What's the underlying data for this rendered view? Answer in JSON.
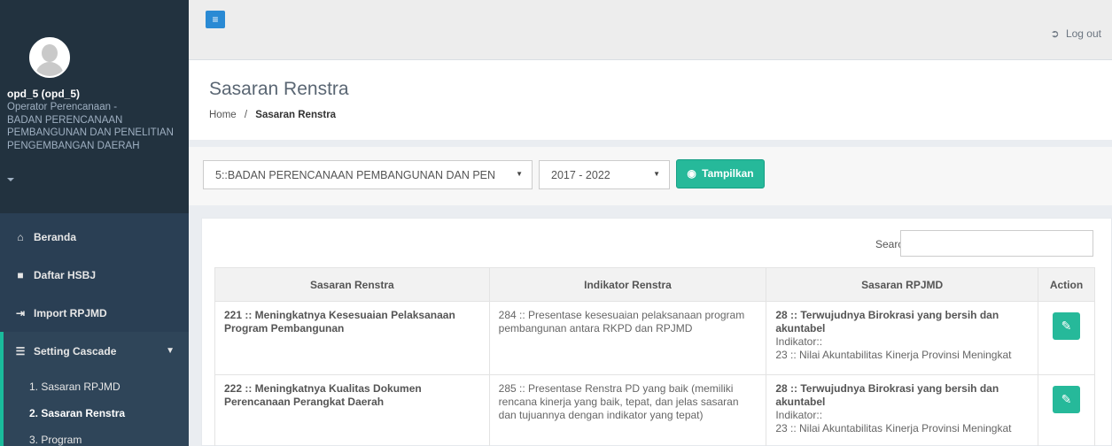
{
  "sidebar": {
    "profile": {
      "name": "opd_5 (opd_5)",
      "role_line1": "Operator Perencanaan -",
      "role_line2": "BADAN PERENCANAAN PEMBANGUNAN DAN PENELITIAN PENGEMBANGAN DAERAH"
    },
    "menu": [
      {
        "label": "Beranda",
        "icon": "home-icon"
      },
      {
        "label": "Daftar HSBJ",
        "icon": "book-icon"
      },
      {
        "label": "Import RPJMD",
        "icon": "import-icon"
      },
      {
        "label": "Setting Cascade",
        "icon": "list-icon"
      }
    ],
    "submenu": [
      {
        "label": "1. Sasaran RPJMD"
      },
      {
        "label": "2. Sasaran Renstra"
      },
      {
        "label": "3. Program"
      }
    ]
  },
  "topnav": {
    "toggle_glyph": "≡",
    "logout_label": "Log out"
  },
  "page": {
    "title": "Sasaran Renstra",
    "breadcrumb_home": "Home",
    "breadcrumb_sep": "/",
    "breadcrumb_current": "Sasaran Renstra"
  },
  "filter": {
    "opd_value": "5::BADAN PERENCANAAN PEMBANGUNAN DAN PEN",
    "year_value": "2017 - 2022",
    "show_button": "Tampilkan"
  },
  "table": {
    "search_label": "Search:",
    "headers": [
      "Sasaran Renstra",
      "Indikator Renstra",
      "Sasaran RPJMD",
      "Action"
    ],
    "rows": [
      {
        "sasaran": "221 :: Meningkatnya Kesesuaian Pelaksanaan Program Pembangunan",
        "indikator": "284 :: Presentase kesesuaian pelaksanaan program pembangunan antara RKPD dan RPJMD",
        "rpjmd_title": "28 :: Terwujudnya Birokrasi yang bersih dan akuntabel",
        "rpjmd_ind_label": "Indikator::",
        "rpjmd_ind_value": "23 :: Nilai Akuntabilitas Kinerja Provinsi Meningkat"
      },
      {
        "sasaran": "222 :: Meningkatnya Kualitas Dokumen Perencanaan Perangkat Daerah",
        "indikator": "285 :: Presentase Renstra PD yang baik (memiliki rencana kinerja yang baik, tepat, dan jelas sasaran dan tujuannya dengan indikator yang tepat)",
        "rpjmd_title": "28 :: Terwujudnya Birokrasi yang bersih dan akuntabel",
        "rpjmd_ind_label": "Indikator::",
        "rpjmd_ind_value": "23 :: Nilai Akuntabilitas Kinerja Provinsi Meningkat"
      }
    ]
  },
  "colors": {
    "sidebar_bg": "#2a3f54",
    "accent_green": "#26b99a",
    "toggle_blue": "#2a8ad4"
  }
}
